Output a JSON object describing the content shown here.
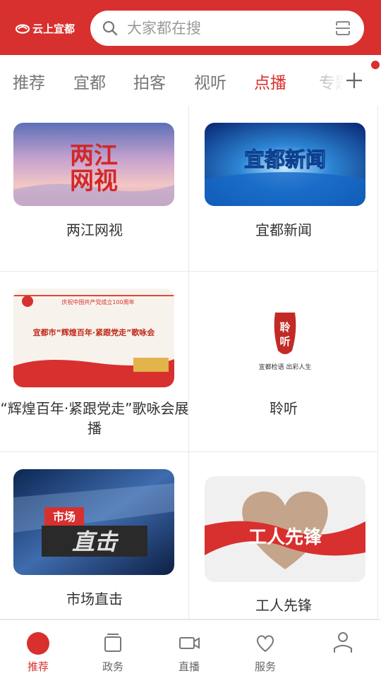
{
  "header": {
    "logo_text": "云上宜都",
    "search_placeholder": "大家都在搜",
    "brand_color": "#d8302e"
  },
  "tabs": [
    {
      "label": "推荐",
      "active": false
    },
    {
      "label": "宜都",
      "active": false
    },
    {
      "label": "拍客",
      "active": false
    },
    {
      "label": "视听",
      "active": false
    },
    {
      "label": "点播",
      "active": true
    },
    {
      "label": "专题",
      "active": false
    }
  ],
  "cards": [
    {
      "title": "两江网视",
      "thumb_text": "两江网视"
    },
    {
      "title": "宜都新闻",
      "thumb_text": "宜都新闻"
    },
    {
      "title": "“辉煌百年·紧跟党走”歌咏会展播",
      "thumb_text": "宜都市“辉煌百年·紧跟党走”歌咏会",
      "thumb_subtext": "庆祝中国共产党成立100周年"
    },
    {
      "title": "聆听",
      "thumb_text": "聆听",
      "thumb_subtext": "宜都检语 出彩人生"
    },
    {
      "title": "市场直击",
      "thumb_text": "直击",
      "thumb_subtext": "市场"
    },
    {
      "title": "工人先锋",
      "thumb_text": "工人先锋"
    }
  ],
  "bottom_nav": [
    {
      "label": "推荐",
      "icon": "home-dot-icon",
      "active": true
    },
    {
      "label": "政务",
      "icon": "government-icon",
      "active": false
    },
    {
      "label": "直播",
      "icon": "video-camera-icon",
      "active": false
    },
    {
      "label": "服务",
      "icon": "heart-service-icon",
      "active": false
    },
    {
      "label": "",
      "icon": "user-icon",
      "active": false
    }
  ]
}
